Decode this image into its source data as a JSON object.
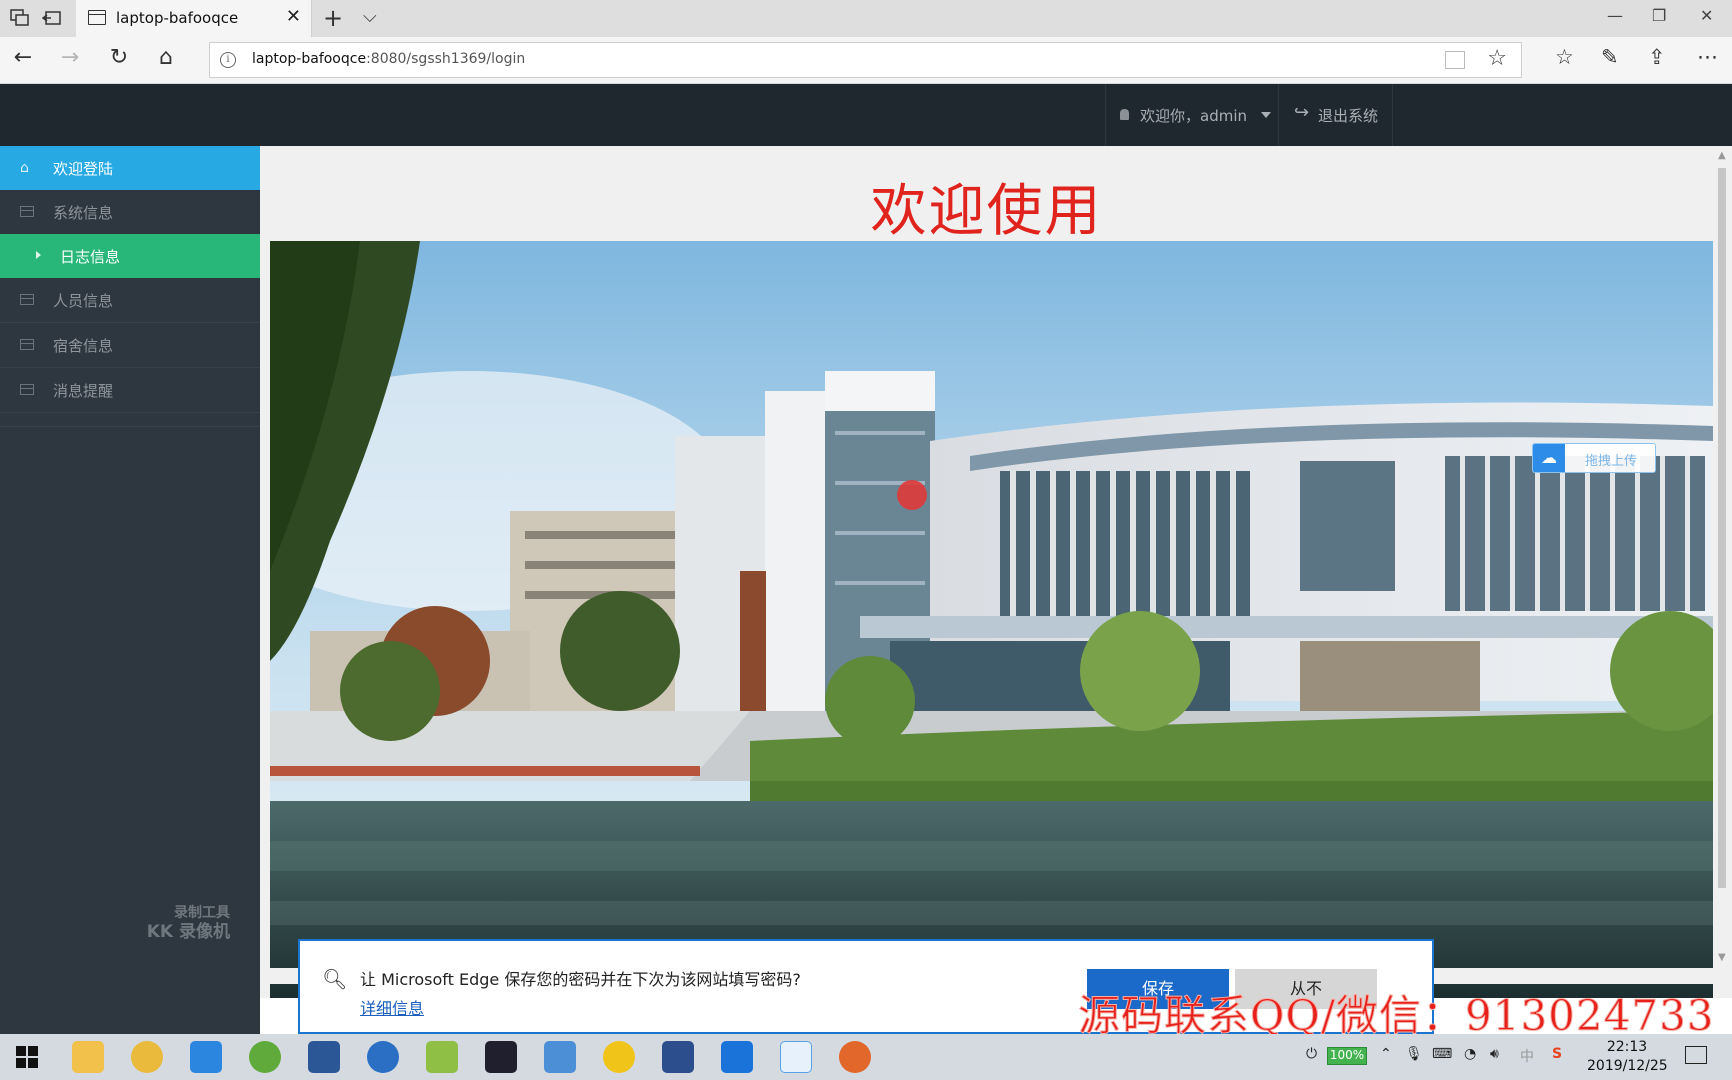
{
  "browser": {
    "tab_title": "laptop-bafooqce",
    "url_host": "laptop-bafooqce",
    "url_rest": ":8080/sgssh1369/login",
    "new_tab": "+",
    "tab_close": "✕"
  },
  "header": {
    "user_label": "欢迎你，admin",
    "logout_label": "退出系统"
  },
  "sidebar": {
    "items": [
      {
        "label": "欢迎登陆",
        "state": "active"
      },
      {
        "label": "系统信息"
      },
      {
        "label": "日志信息",
        "state": "sub-selected"
      },
      {
        "label": "人员信息"
      },
      {
        "label": "宿舍信息"
      },
      {
        "label": "消息提醒"
      }
    ],
    "watermark_line1": "录制工具",
    "watermark_line2": "KK 录像机"
  },
  "main": {
    "welcome_title": "欢迎使用",
    "hero_image": "campus-building-photo"
  },
  "overlays": {
    "baidu_badge": "拖拽上传",
    "contact": "源码联系QQ/微信：913024733"
  },
  "password_prompt": {
    "message": "让 Microsoft Edge 保存您的密码并在下次为该网站填写密码?",
    "details_link": "详细信息",
    "save_button": "保存",
    "never_button": "从不"
  },
  "taskbar": {
    "battery": "100%",
    "time": "22:13",
    "date": "2019/12/25",
    "ime": "中"
  },
  "colors": {
    "header_bg": "#1f272f",
    "sidebar_bg": "#2e363f",
    "active_blue": "#27a9e3",
    "sub_green": "#28b779",
    "welcome_red": "#e0231c",
    "edge_blue": "#1b6ac9"
  }
}
